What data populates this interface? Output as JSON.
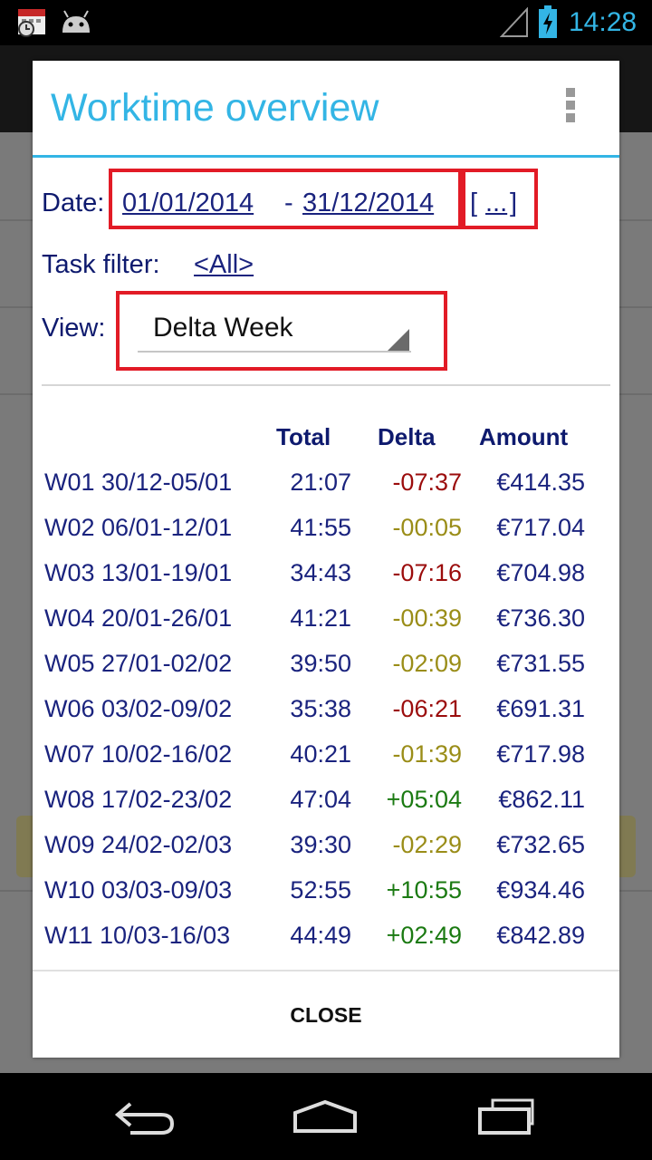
{
  "status_bar": {
    "time": "14:28"
  },
  "dialog": {
    "title": "Worktime overview",
    "date_label": "Date:",
    "date_from": "01/01/2014",
    "date_separator": "-",
    "date_to": "31/12/2014",
    "date_more_open": "[",
    "date_more": "...",
    "date_more_close": "]",
    "task_filter_label": "Task filter:",
    "task_filter_value": "<All>",
    "view_label": "View:",
    "view_value": "Delta Week",
    "columns": {
      "total": "Total",
      "delta": "Delta",
      "amount": "Amount"
    },
    "rows": [
      {
        "week": "W01 30/12-05/01",
        "total": "21:07",
        "delta": "-07:37",
        "amount": "€414.35",
        "delta_color": "#9b0c0c"
      },
      {
        "week": "W02 06/01-12/01",
        "total": "41:55",
        "delta": "-00:05",
        "amount": "€717.04",
        "delta_color": "#9a8d18"
      },
      {
        "week": "W03 13/01-19/01",
        "total": "34:43",
        "delta": "-07:16",
        "amount": "€704.98",
        "delta_color": "#9b0c0c"
      },
      {
        "week": "W04 20/01-26/01",
        "total": "41:21",
        "delta": "-00:39",
        "amount": "€736.30",
        "delta_color": "#9a8d18"
      },
      {
        "week": "W05 27/01-02/02",
        "total": "39:50",
        "delta": "-02:09",
        "amount": "€731.55",
        "delta_color": "#9a8d18"
      },
      {
        "week": "W06 03/02-09/02",
        "total": "35:38",
        "delta": "-06:21",
        "amount": "€691.31",
        "delta_color": "#9b0c0c"
      },
      {
        "week": "W07 10/02-16/02",
        "total": "40:21",
        "delta": "-01:39",
        "amount": "€717.98",
        "delta_color": "#9a8d18"
      },
      {
        "week": "W08 17/02-23/02",
        "total": "47:04",
        "delta": "+05:04",
        "amount": "€862.11",
        "delta_color": "#1b7a12"
      },
      {
        "week": "W09 24/02-02/03",
        "total": "39:30",
        "delta": "-02:29",
        "amount": "€732.65",
        "delta_color": "#9a8d18"
      },
      {
        "week": "W10 03/03-09/03",
        "total": "52:55",
        "delta": "+10:55",
        "amount": "€934.46",
        "delta_color": "#1b7a12"
      },
      {
        "week": "W11 10/03-16/03",
        "total": "44:49",
        "delta": "+02:49",
        "amount": "€842.89",
        "delta_color": "#1b7a12"
      }
    ],
    "close_label": "CLOSE"
  },
  "colors": {
    "accent": "#33b5e5",
    "highlight_box": "#e21b26",
    "negative": "#9b0c0c",
    "small_negative": "#9a8d18",
    "positive": "#1b7a12"
  }
}
